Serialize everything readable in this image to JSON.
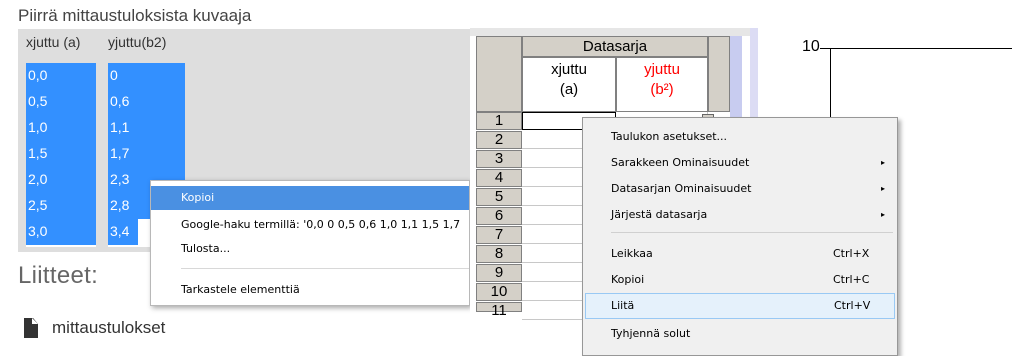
{
  "web": {
    "title": "Piirrä mittaustuloksista kuvaaja",
    "col_a_header": "xjuttu (a)",
    "col_b_header": "yjuttu(b2)",
    "col_a_values": [
      "0,0",
      "0,5",
      "1,0",
      "1,5",
      "2,0",
      "2,5",
      "3,0"
    ],
    "col_b_values": [
      "0",
      "0,6",
      "1,1",
      "1,7",
      "2,3",
      "2,8",
      "3,4"
    ],
    "attachments_heading": "Liitteet:",
    "attachment_link": "mittaustulokset"
  },
  "browser_menu": {
    "items": [
      {
        "label": "Kopioi",
        "highlighted": true
      },
      {
        "label": "Google-haku termillä: '0,0 0 0,5 0,6 1,0 1,1 1,5 1,7",
        "highlighted": false
      },
      {
        "label": "Tulosta...",
        "highlighted": false
      },
      {
        "label": "Tarkastele elementtiä",
        "highlighted": false
      }
    ]
  },
  "spreadsheet": {
    "group_header": "Datasarja",
    "columns": [
      {
        "line1": "xjuttu",
        "line2": "(a)",
        "color": "#000000"
      },
      {
        "line1": "yjuttu",
        "line2": "(b²)",
        "color": "#ff0000"
      }
    ],
    "row_numbers": [
      "1",
      "2",
      "3",
      "4",
      "5",
      "6",
      "7",
      "8",
      "9",
      "10",
      "11"
    ],
    "dropdown_glyph": "▲"
  },
  "sheet_menu": {
    "items": [
      {
        "label": "Taulukon asetukset...",
        "shortcut": "",
        "submenu": false,
        "highlighted": false
      },
      {
        "label": "Sarakkeen Ominaisuudet",
        "shortcut": "",
        "submenu": true,
        "highlighted": false
      },
      {
        "label": "Datasarjan Ominaisuudet",
        "shortcut": "",
        "submenu": true,
        "highlighted": false
      },
      {
        "label": "Järjestä datasarja",
        "shortcut": "",
        "submenu": true,
        "highlighted": false
      },
      {
        "label": "Leikkaa",
        "shortcut": "Ctrl+X",
        "submenu": false,
        "highlighted": false
      },
      {
        "label": "Kopioi",
        "shortcut": "Ctrl+C",
        "submenu": false,
        "highlighted": false
      },
      {
        "label": "Liitä",
        "shortcut": "Ctrl+V",
        "submenu": false,
        "highlighted": true
      },
      {
        "label": "Tyhjennä solut",
        "shortcut": "",
        "submenu": false,
        "highlighted": false
      }
    ],
    "submenu_glyph": "▸"
  },
  "graph": {
    "y_tick_top": "10"
  },
  "colors": {
    "selection_blue": "#3390ff",
    "menu_highlight_blue": "#4a90e2",
    "spreadsheet_header_gray": "#d4d0c8",
    "column_b_red": "#ff0000",
    "windows_menu_highlight": "#e5f1fb"
  }
}
